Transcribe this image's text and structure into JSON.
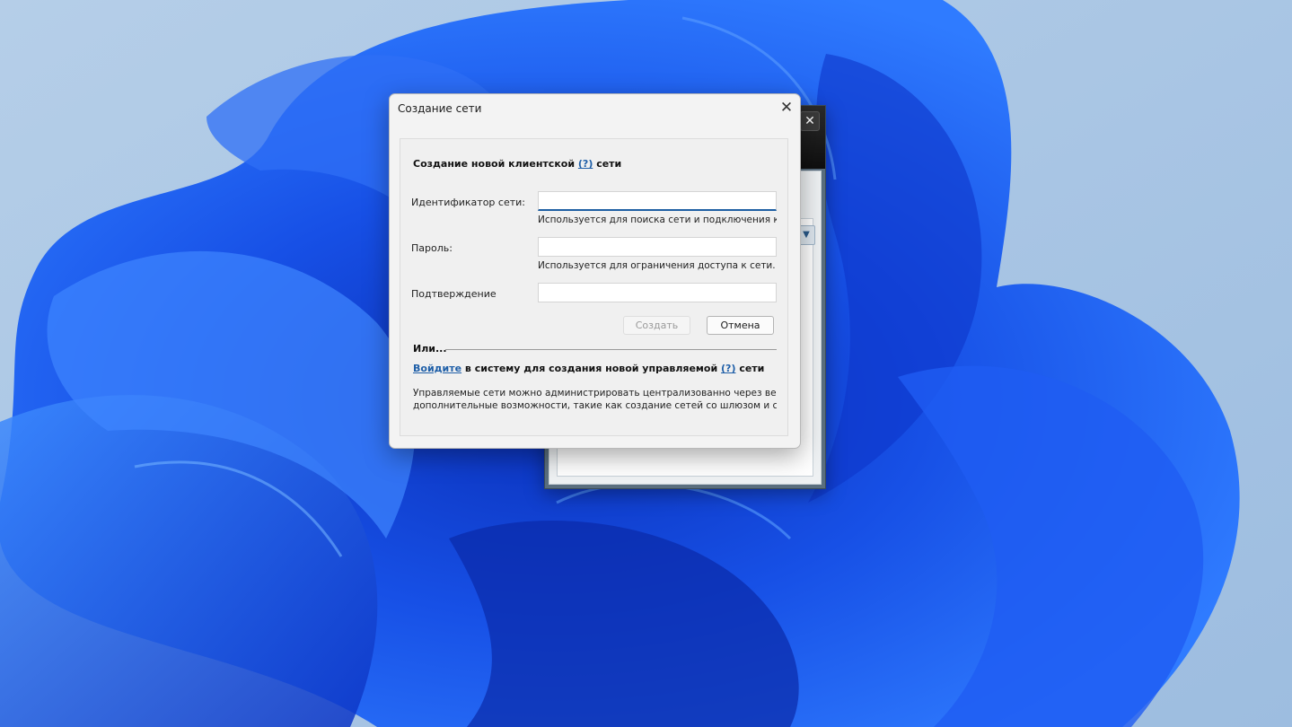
{
  "dialog": {
    "title": "Создание сети",
    "close_glyph": "✕",
    "heading_prefix": "Создание новой клиентской",
    "heading_help": "(?)",
    "heading_suffix": "сети",
    "fields": {
      "network_id": {
        "label": "Идентификатор сети:",
        "value": "",
        "hint": "Используется для поиска сети и подключения к"
      },
      "password": {
        "label": "Пароль:",
        "value": "",
        "hint": "Используется для ограничения доступа к сети."
      },
      "confirm": {
        "label": "Подтверждение",
        "value": ""
      }
    },
    "create_label": "Создать",
    "cancel_label": "Отмена",
    "or_label": "Или...",
    "signin_link": "Войдите",
    "signin_text": "в систему для создания новой управляемой",
    "signin_help": "(?)",
    "signin_suffix": "сети",
    "description_line1": "Управляемые сети можно администрировать централизованно через веб-ин",
    "description_line2": "дополнительные возможности, такие как создание сетей со шлюзом и сетей"
  },
  "background_window": {
    "close_glyph": "✕",
    "dropdown_glyph": "▼"
  },
  "icons": {
    "dialog_close": "close-icon",
    "background_close": "close-icon",
    "dropdown": "chevron-down-icon"
  },
  "colors": {
    "link": "#1f5fa8",
    "focus_border": "#1e5fa3",
    "wallpaper_sky": "#a9c6e6",
    "wallpaper_bloom": "#1a5bf0"
  }
}
